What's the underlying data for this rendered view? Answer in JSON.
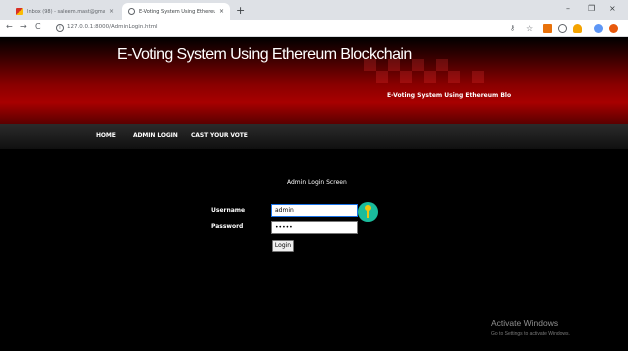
{
  "browser": {
    "tabs": [
      {
        "title": "Inbox (98) - saleem.mast@gmai",
        "close": "×"
      },
      {
        "title": "E-Voting System Using Ethereum",
        "close": "×"
      }
    ],
    "new_tab": "+",
    "window_controls": {
      "minimize": "–",
      "maximize": "❐",
      "close": "×"
    },
    "nav": {
      "back": "←",
      "forward": "→",
      "reload": "C"
    },
    "url": "127.0.0.1:8000/AdminLogin.html"
  },
  "header": {
    "site_title": "E-Voting System Using Ethereum Blockchain",
    "sub_title": "E-Voting System Using Ethereum Blo"
  },
  "nav": {
    "home": "HOME",
    "admin_login": "ADMIN LOGIN",
    "cast_vote": "CAST YOUR VOTE"
  },
  "form": {
    "screen_title": "Admin Login Screen",
    "username_label": "Username",
    "username_value": "admin",
    "password_label": "Password",
    "password_value": "admin",
    "login_button": "Login"
  },
  "watermark": {
    "title": "Activate Windows",
    "subtitle": "Go to Settings to activate Windows."
  },
  "colors": {
    "header_red": "#a80000",
    "key_button": "#1abc9c",
    "key_icon": "#f1c40f"
  }
}
